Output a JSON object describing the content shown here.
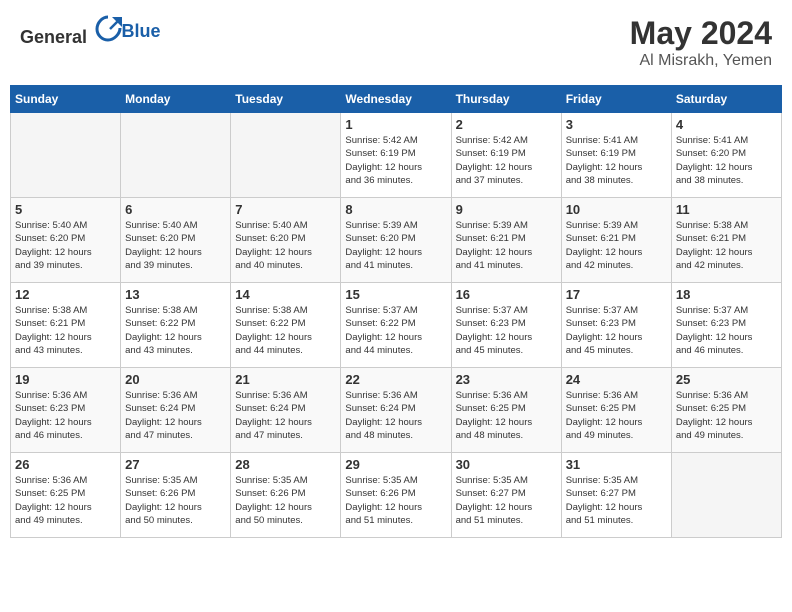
{
  "header": {
    "logo_general": "General",
    "logo_blue": "Blue",
    "month": "May 2024",
    "location": "Al Misrakh, Yemen"
  },
  "weekdays": [
    "Sunday",
    "Monday",
    "Tuesday",
    "Wednesday",
    "Thursday",
    "Friday",
    "Saturday"
  ],
  "weeks": [
    [
      {
        "day": "",
        "info": ""
      },
      {
        "day": "",
        "info": ""
      },
      {
        "day": "",
        "info": ""
      },
      {
        "day": "1",
        "info": "Sunrise: 5:42 AM\nSunset: 6:19 PM\nDaylight: 12 hours\nand 36 minutes."
      },
      {
        "day": "2",
        "info": "Sunrise: 5:42 AM\nSunset: 6:19 PM\nDaylight: 12 hours\nand 37 minutes."
      },
      {
        "day": "3",
        "info": "Sunrise: 5:41 AM\nSunset: 6:19 PM\nDaylight: 12 hours\nand 38 minutes."
      },
      {
        "day": "4",
        "info": "Sunrise: 5:41 AM\nSunset: 6:20 PM\nDaylight: 12 hours\nand 38 minutes."
      }
    ],
    [
      {
        "day": "5",
        "info": "Sunrise: 5:40 AM\nSunset: 6:20 PM\nDaylight: 12 hours\nand 39 minutes."
      },
      {
        "day": "6",
        "info": "Sunrise: 5:40 AM\nSunset: 6:20 PM\nDaylight: 12 hours\nand 39 minutes."
      },
      {
        "day": "7",
        "info": "Sunrise: 5:40 AM\nSunset: 6:20 PM\nDaylight: 12 hours\nand 40 minutes."
      },
      {
        "day": "8",
        "info": "Sunrise: 5:39 AM\nSunset: 6:20 PM\nDaylight: 12 hours\nand 41 minutes."
      },
      {
        "day": "9",
        "info": "Sunrise: 5:39 AM\nSunset: 6:21 PM\nDaylight: 12 hours\nand 41 minutes."
      },
      {
        "day": "10",
        "info": "Sunrise: 5:39 AM\nSunset: 6:21 PM\nDaylight: 12 hours\nand 42 minutes."
      },
      {
        "day": "11",
        "info": "Sunrise: 5:38 AM\nSunset: 6:21 PM\nDaylight: 12 hours\nand 42 minutes."
      }
    ],
    [
      {
        "day": "12",
        "info": "Sunrise: 5:38 AM\nSunset: 6:21 PM\nDaylight: 12 hours\nand 43 minutes."
      },
      {
        "day": "13",
        "info": "Sunrise: 5:38 AM\nSunset: 6:22 PM\nDaylight: 12 hours\nand 43 minutes."
      },
      {
        "day": "14",
        "info": "Sunrise: 5:38 AM\nSunset: 6:22 PM\nDaylight: 12 hours\nand 44 minutes."
      },
      {
        "day": "15",
        "info": "Sunrise: 5:37 AM\nSunset: 6:22 PM\nDaylight: 12 hours\nand 44 minutes."
      },
      {
        "day": "16",
        "info": "Sunrise: 5:37 AM\nSunset: 6:23 PM\nDaylight: 12 hours\nand 45 minutes."
      },
      {
        "day": "17",
        "info": "Sunrise: 5:37 AM\nSunset: 6:23 PM\nDaylight: 12 hours\nand 45 minutes."
      },
      {
        "day": "18",
        "info": "Sunrise: 5:37 AM\nSunset: 6:23 PM\nDaylight: 12 hours\nand 46 minutes."
      }
    ],
    [
      {
        "day": "19",
        "info": "Sunrise: 5:36 AM\nSunset: 6:23 PM\nDaylight: 12 hours\nand 46 minutes."
      },
      {
        "day": "20",
        "info": "Sunrise: 5:36 AM\nSunset: 6:24 PM\nDaylight: 12 hours\nand 47 minutes."
      },
      {
        "day": "21",
        "info": "Sunrise: 5:36 AM\nSunset: 6:24 PM\nDaylight: 12 hours\nand 47 minutes."
      },
      {
        "day": "22",
        "info": "Sunrise: 5:36 AM\nSunset: 6:24 PM\nDaylight: 12 hours\nand 48 minutes."
      },
      {
        "day": "23",
        "info": "Sunrise: 5:36 AM\nSunset: 6:25 PM\nDaylight: 12 hours\nand 48 minutes."
      },
      {
        "day": "24",
        "info": "Sunrise: 5:36 AM\nSunset: 6:25 PM\nDaylight: 12 hours\nand 49 minutes."
      },
      {
        "day": "25",
        "info": "Sunrise: 5:36 AM\nSunset: 6:25 PM\nDaylight: 12 hours\nand 49 minutes."
      }
    ],
    [
      {
        "day": "26",
        "info": "Sunrise: 5:36 AM\nSunset: 6:25 PM\nDaylight: 12 hours\nand 49 minutes."
      },
      {
        "day": "27",
        "info": "Sunrise: 5:35 AM\nSunset: 6:26 PM\nDaylight: 12 hours\nand 50 minutes."
      },
      {
        "day": "28",
        "info": "Sunrise: 5:35 AM\nSunset: 6:26 PM\nDaylight: 12 hours\nand 50 minutes."
      },
      {
        "day": "29",
        "info": "Sunrise: 5:35 AM\nSunset: 6:26 PM\nDaylight: 12 hours\nand 51 minutes."
      },
      {
        "day": "30",
        "info": "Sunrise: 5:35 AM\nSunset: 6:27 PM\nDaylight: 12 hours\nand 51 minutes."
      },
      {
        "day": "31",
        "info": "Sunrise: 5:35 AM\nSunset: 6:27 PM\nDaylight: 12 hours\nand 51 minutes."
      },
      {
        "day": "",
        "info": ""
      }
    ]
  ]
}
